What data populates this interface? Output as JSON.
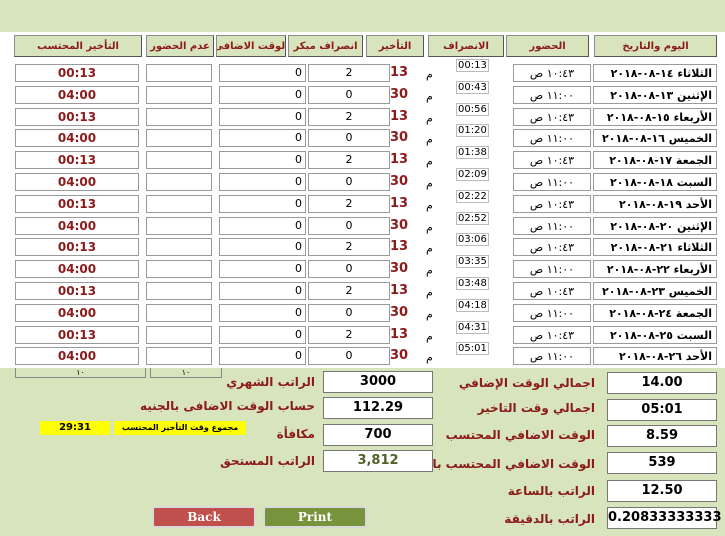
{
  "headers": {
    "date": "اليوم والتاريخ",
    "arrive": "الحضور",
    "leave": "الانصراف",
    "delay": "التأخير",
    "early": "انصراف مبكر",
    "overtime": "الوقت الاضافى",
    "absent": "عدم الحضور",
    "delay_calc": "التأخير المحتسب"
  },
  "rows": [
    {
      "date": "الثلاثاء ١٤-٠٨-٢٠١٨",
      "arrive": "١٠:٤٣ ص",
      "leave_time": "00:13",
      "leave_suffix": "م",
      "delay": "13",
      "early": "2",
      "overtime": "0",
      "delay_calc": "00:13"
    },
    {
      "date": "الإثنين ١٣-٠٨-٢٠١٨",
      "arrive": "١١:٠٠ ص",
      "leave_time": "00:43",
      "leave_suffix": "م",
      "delay": "30",
      "early": "0",
      "overtime": "0",
      "delay_calc": "04:00"
    },
    {
      "date": "الأربعاء ١٥-٠٨-٢٠١٨",
      "arrive": "١٠:٤٣ ص",
      "leave_time": "00:56",
      "leave_suffix": "م",
      "delay": "13",
      "early": "2",
      "overtime": "0",
      "delay_calc": "00:13"
    },
    {
      "date": "الخميس ١٦-٠٨-٢٠١٨",
      "arrive": "١١:٠٠ ص",
      "leave_time": "01:20",
      "leave_suffix": "م",
      "delay": "30",
      "early": "0",
      "overtime": "0",
      "delay_calc": "04:00"
    },
    {
      "date": "الجمعة ١٧-٠٨-٢٠١٨",
      "arrive": "١٠:٤٣ ص",
      "leave_time": "01:38",
      "leave_suffix": "م",
      "delay": "13",
      "early": "2",
      "overtime": "0",
      "delay_calc": "00:13"
    },
    {
      "date": "السبت ١٨-٠٨-٢٠١٨",
      "arrive": "١١:٠٠ ص",
      "leave_time": "02:09",
      "leave_suffix": "م",
      "delay": "30",
      "early": "0",
      "overtime": "0",
      "delay_calc": "04:00"
    },
    {
      "date": "الأحد ١٩-٠٨-٢٠١٨",
      "arrive": "١٠:٤٣ ص",
      "leave_time": "02:22",
      "leave_suffix": "م",
      "delay": "13",
      "early": "2",
      "overtime": "0",
      "delay_calc": "00:13"
    },
    {
      "date": "الإثنين ٢٠-٠٨-٢٠١٨",
      "arrive": "١١:٠٠ ص",
      "leave_time": "02:52",
      "leave_suffix": "م",
      "delay": "30",
      "early": "0",
      "overtime": "0",
      "delay_calc": "04:00"
    },
    {
      "date": "الثلاثاء ٢١-٠٨-٢٠١٨",
      "arrive": "١٠:٤٣ ص",
      "leave_time": "03:06",
      "leave_suffix": "م",
      "delay": "13",
      "early": "2",
      "overtime": "0",
      "delay_calc": "00:13"
    },
    {
      "date": "الأربعاء ٢٢-٠٨-٢٠١٨",
      "arrive": "١١:٠٠ ص",
      "leave_time": "03:35",
      "leave_suffix": "م",
      "delay": "30",
      "early": "0",
      "overtime": "0",
      "delay_calc": "04:00"
    },
    {
      "date": "الخميس ٢٣-٠٨-٢٠١٨",
      "arrive": "١٠:٤٣ ص",
      "leave_time": "03:48",
      "leave_suffix": "م",
      "delay": "13",
      "early": "2",
      "overtime": "0",
      "delay_calc": "00:13"
    },
    {
      "date": "الجمعة ٢٤-٠٨-٢٠١٨",
      "arrive": "١١:٠٠ ص",
      "leave_time": "04:18",
      "leave_suffix": "م",
      "delay": "30",
      "early": "0",
      "overtime": "0",
      "delay_calc": "04:00"
    },
    {
      "date": "السبت ٢٥-٠٨-٢٠١٨",
      "arrive": "١٠:٤٣ ص",
      "leave_time": "04:31",
      "leave_suffix": "م",
      "delay": "13",
      "early": "2",
      "overtime": "0",
      "delay_calc": "00:13"
    },
    {
      "date": "الأحد ٢٦-٠٨-٢٠١٨",
      "arrive": "١١:٠٠ ص",
      "leave_time": "05:01",
      "leave_suffix": "م",
      "delay": "30",
      "early": "0",
      "overtime": "0",
      "delay_calc": "04:00"
    }
  ],
  "summary": {
    "total_overtime_label": "اجمالي الوقت الإضافي",
    "total_overtime": "14.00",
    "total_delay_label": "اجمالي وقت التاخير",
    "total_delay": "05:01",
    "calc_overtime_label": "الوقت الاضافي المحتسب",
    "calc_overtime": "8.59",
    "calc_overtime_min_label": "الوقت الاضافي المحتسب بالدقائق",
    "calc_overtime_min": "539",
    "hourly_label": "الراتب بالساعة",
    "hourly": "12.50",
    "minute_label": "الراتب بالدقيقة",
    "minute": "0.20833333333",
    "monthly_label": "الراتب الشهري",
    "monthly": "3000",
    "overtime_pound_label": "حساب الوقت الاضافى بالجنيه",
    "overtime_pound": "112.29",
    "bonus_label": "مكافأة",
    "bonus": "700",
    "due_label": "الراتب المستحق",
    "due": "3,812",
    "delay_sum_label": "مجموع وقت التأخير المحتسب",
    "delay_sum": "29:31",
    "tab_left": "١٠",
    "tab_right": "١٠"
  },
  "buttons": {
    "back": "Back",
    "print": "Print"
  }
}
